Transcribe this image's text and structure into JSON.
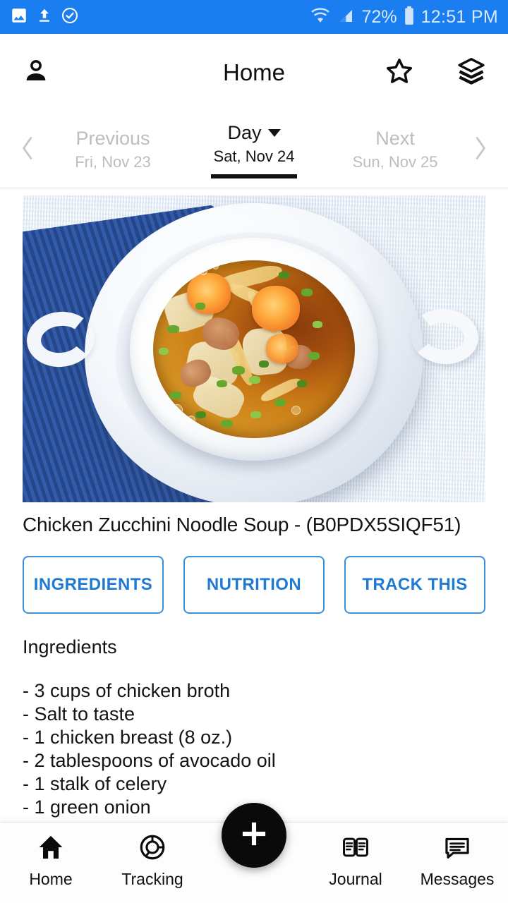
{
  "status_bar": {
    "background": "#1a7df0",
    "left_icons": [
      "image-icon",
      "upload-icon",
      "check-circle-icon"
    ],
    "right_icons": [
      "wifi-icon",
      "cell-signal-icon",
      "battery-icon"
    ],
    "battery_percent": "72%",
    "time": "12:51 PM"
  },
  "app_bar": {
    "title": "Home",
    "left_icon": "person-icon",
    "right_icons": [
      "star-outline-icon",
      "layers-icon"
    ]
  },
  "date_nav": {
    "prev_chevron": "‹",
    "next_chevron": "›",
    "previous": {
      "label": "Previous",
      "date": "Fri, Nov 23"
    },
    "current": {
      "label": "Day",
      "date": "Sat, Nov 24",
      "caret": "caret-down-icon"
    },
    "next": {
      "label": "Next",
      "date": "Sun, Nov 25"
    }
  },
  "recipe": {
    "image_alt": "bowl-of-chicken-noodle-soup",
    "title": "Chicken Zucchini Noodle Soup - (B0PDX5SIQF51)",
    "buttons": [
      {
        "label": "INGREDIENTS"
      },
      {
        "label": "NUTRITION"
      },
      {
        "label": "TRACK THIS"
      }
    ],
    "accent_color": "#1f7ad4",
    "section_heading": "Ingredients",
    "ingredients": [
      "- 3 cups of chicken broth",
      "- Salt to taste",
      "- 1 chicken breast (8 oz.)",
      "- 2 tablespoons of avocado oil",
      "- 1 stalk of celery",
      "- 1 green onion"
    ]
  },
  "bottom_nav": {
    "items": [
      {
        "label": "Home",
        "icon": "home-icon"
      },
      {
        "label": "Tracking",
        "icon": "donut-chart-icon"
      },
      {
        "label": "Journal",
        "icon": "book-icon"
      },
      {
        "label": "Messages",
        "icon": "chat-bubble-icon"
      }
    ],
    "fab": {
      "icon": "plus-icon",
      "color": "#0a0a0a"
    }
  }
}
